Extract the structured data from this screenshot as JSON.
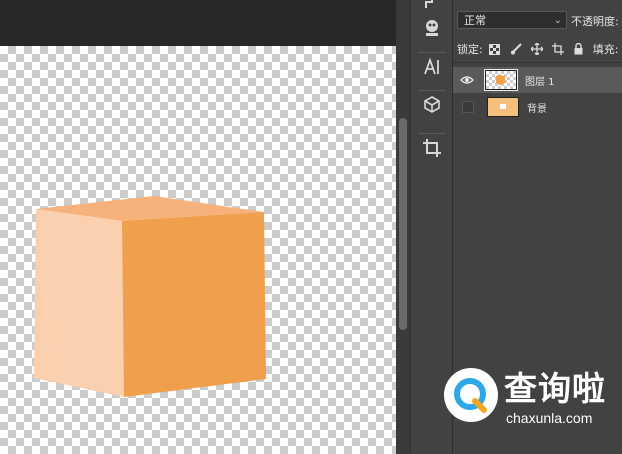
{
  "canvas": {
    "checker_colors": [
      "#ffffff",
      "#cccccc"
    ],
    "cube_colors": {
      "left_face": "#fbd0ae",
      "right_face": "#f0a04c",
      "top_face": "#f6b27a"
    }
  },
  "toolstrip": {
    "tools": [
      {
        "icon": "brush-preset-icon"
      },
      {
        "icon": "clone-source-icon"
      },
      {
        "icon": "character-icon"
      },
      {
        "icon": "3d-icon"
      },
      {
        "icon": "crop-icon"
      }
    ]
  },
  "layers_panel": {
    "blend_mode": "正常",
    "opacity_label": "不透明度:",
    "lock_label": "锁定:",
    "fill_label": "填充:",
    "layers": [
      {
        "name": "图层 1",
        "visible": true,
        "active": true
      },
      {
        "name": "背景",
        "visible": false,
        "active": false
      }
    ]
  },
  "watermark": {
    "brand": "查询啦",
    "url": "chaxunla.com",
    "accent": "#2ea8e6"
  }
}
